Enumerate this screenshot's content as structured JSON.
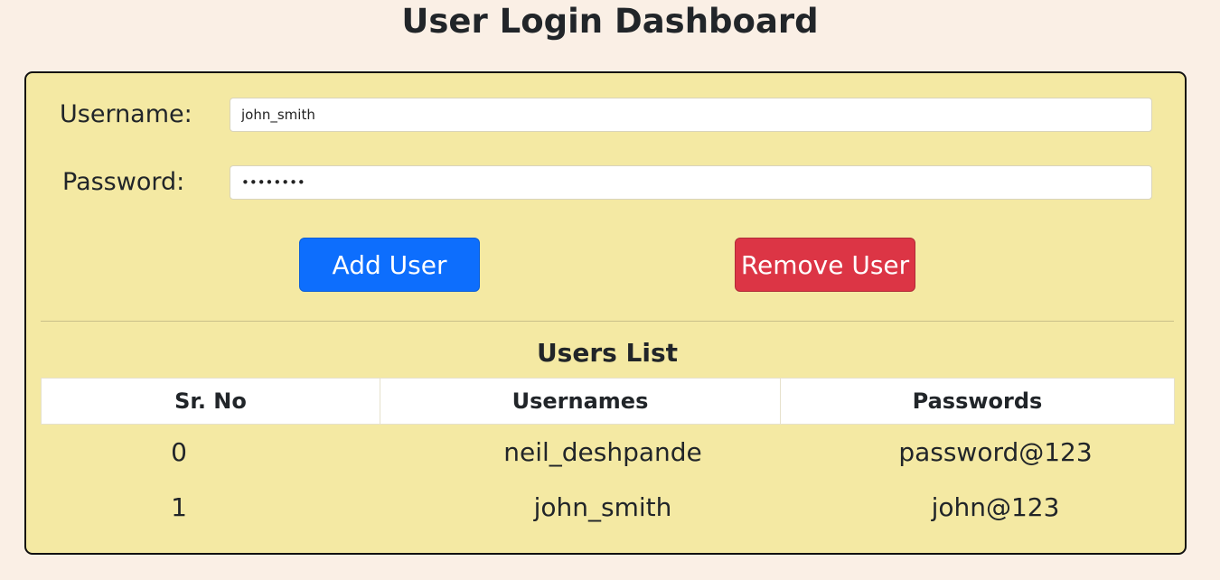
{
  "page": {
    "title": "User Login Dashboard"
  },
  "form": {
    "username_label": "Username:",
    "username_value": "john_smith",
    "password_label": "Password:",
    "password_value": "john@123"
  },
  "buttons": {
    "add_label": "Add User",
    "remove_label": "Remove User"
  },
  "users": {
    "title": "Users List",
    "columns": [
      "Sr. No",
      "Usernames",
      "Passwords"
    ],
    "rows": [
      [
        "0",
        "neil_deshpande",
        "password@123"
      ],
      [
        "1",
        "john_smith",
        "john@123"
      ]
    ]
  },
  "colors": {
    "page_background": "#faefe5",
    "card_background": "#f4e9a3",
    "primary": "#0d6efd",
    "danger": "#dc3545"
  }
}
